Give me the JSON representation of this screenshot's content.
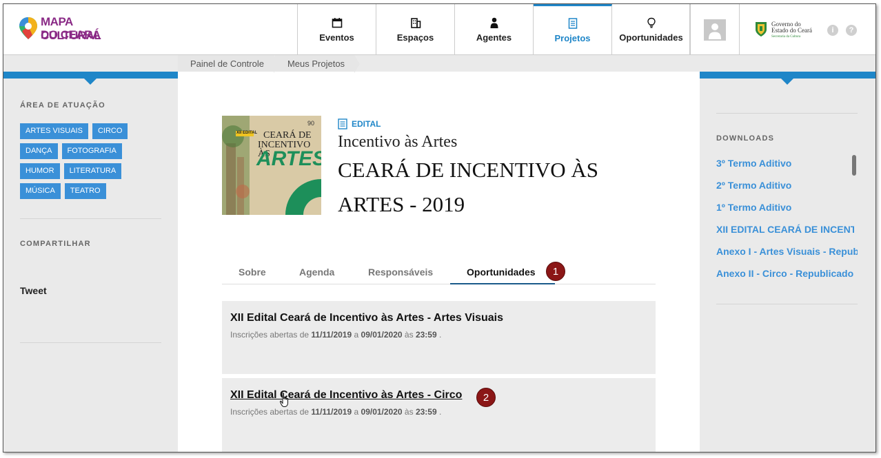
{
  "header": {
    "logo_line1": "MAPA CULTURAL",
    "logo_line2": "DO CEARÁ",
    "nav": [
      {
        "label": "Eventos",
        "icon": "calendar-icon"
      },
      {
        "label": "Espaços",
        "icon": "building-icon"
      },
      {
        "label": "Agentes",
        "icon": "person-icon"
      },
      {
        "label": "Projetos",
        "icon": "document-icon"
      },
      {
        "label": "Oportunidades",
        "icon": "lightbulb-icon"
      }
    ],
    "active_nav": "Projetos",
    "gov_line1": "Governo do",
    "gov_line2": "Estado do Ceará",
    "gov_line3": "Secretaria da Cultura",
    "info_icon": "i",
    "help_icon": "?"
  },
  "breadcrumb": [
    "Painel de Controle",
    "Meus Projetos"
  ],
  "left": {
    "area_title": "ÁREA DE ATUAÇÃO",
    "tags": [
      "ARTES VISUAIS",
      "CIRCO",
      "DANÇA",
      "FOTOGRAFIA",
      "HUMOR",
      "LITERATURA",
      "MÚSICA",
      "TEATRO"
    ],
    "share_title": "COMPARTILHAR",
    "tweet": "Tweet"
  },
  "project": {
    "cover_line1": "XII EDITAL",
    "cover_line2": "CEARÁ DE",
    "cover_line3": "INCENTIVO ÀS",
    "cover_line4": "ARTES",
    "cover_num": "90",
    "type_label": "EDITAL",
    "subtitle": "Incentivo às Artes",
    "title": "CEARÁ DE INCENTIVO ÀS ARTES - 2019"
  },
  "tabs": [
    "Sobre",
    "Agenda",
    "Responsáveis",
    "Oportunidades"
  ],
  "active_tab": "Oportunidades",
  "badges": [
    "1",
    "2"
  ],
  "opportunities": [
    {
      "title": "XII Edital Ceará de Incentivo às Artes - Artes Visuais",
      "info_prefix": "Inscrições abertas de",
      "from": "11/11/2019",
      "to_word": "a",
      "to": "09/01/2020",
      "at_word": "às",
      "time": "23:59",
      "end": "."
    },
    {
      "title": "XII Edital Ceará de Incentivo às Artes - Circo",
      "info_prefix": "Inscrições abertas de",
      "from": "11/11/2019",
      "to_word": "a",
      "to": "09/01/2020",
      "at_word": "às",
      "time": "23:59",
      "end": "."
    }
  ],
  "right": {
    "downloads_title": "DOWNLOADS",
    "downloads": [
      "3º Termo Aditivo",
      "2º Termo Aditivo",
      "1º Termo Aditivo",
      "XII EDITAL CEARÁ DE INCENTIVO",
      "Anexo I - Artes Visuais - Republicado",
      "Anexo II - Circo - Republicado"
    ]
  },
  "colors": {
    "accent": "#1f86c8",
    "link": "#3a90d8",
    "badge": "#8b1616",
    "logo": "#8a2a86"
  }
}
